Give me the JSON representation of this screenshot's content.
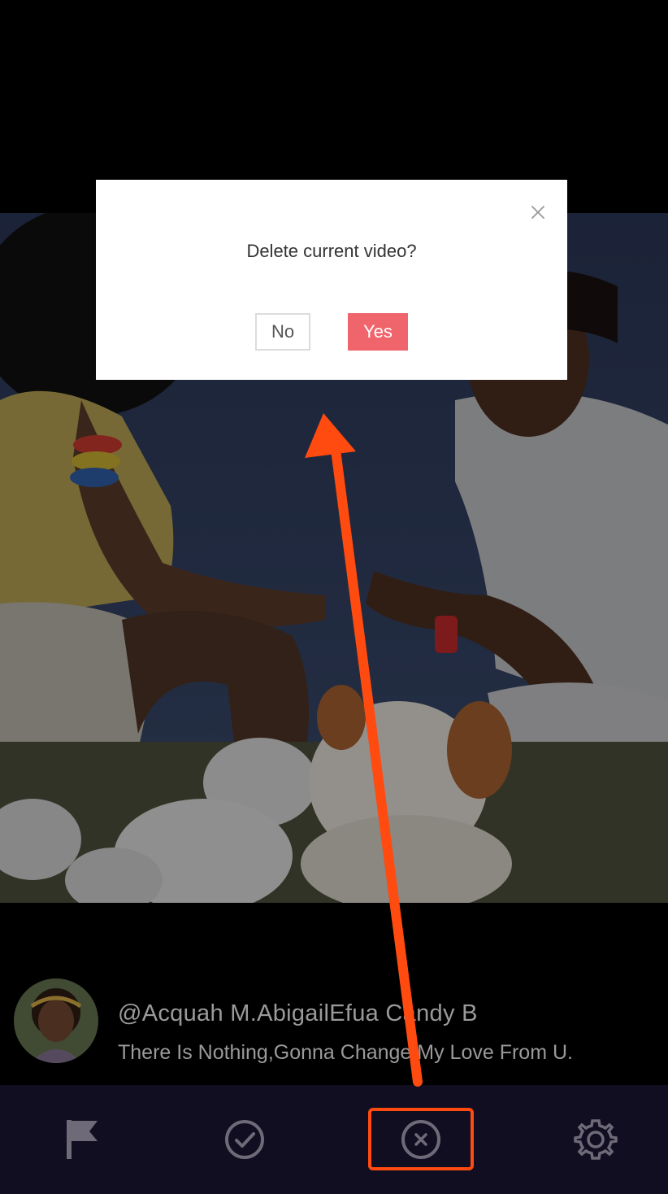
{
  "dialog": {
    "message": "Delete current video?",
    "no_label": "No",
    "yes_label": "Yes",
    "close_icon": "close-icon"
  },
  "video": {
    "username": "@Acquah M.AbigailEfua Candy B",
    "caption": "There Is Nothing,Gonna Change My Love From U."
  },
  "toolbar": {
    "items": [
      {
        "icon": "flag-icon"
      },
      {
        "icon": "check-circle-icon"
      },
      {
        "icon": "close-circle-icon"
      },
      {
        "icon": "gear-icon"
      }
    ]
  },
  "colors": {
    "accent": "#f0646c",
    "annotation": "#ff4a10",
    "bar_background": "#120e21",
    "icon_color": "#6e6a78"
  }
}
